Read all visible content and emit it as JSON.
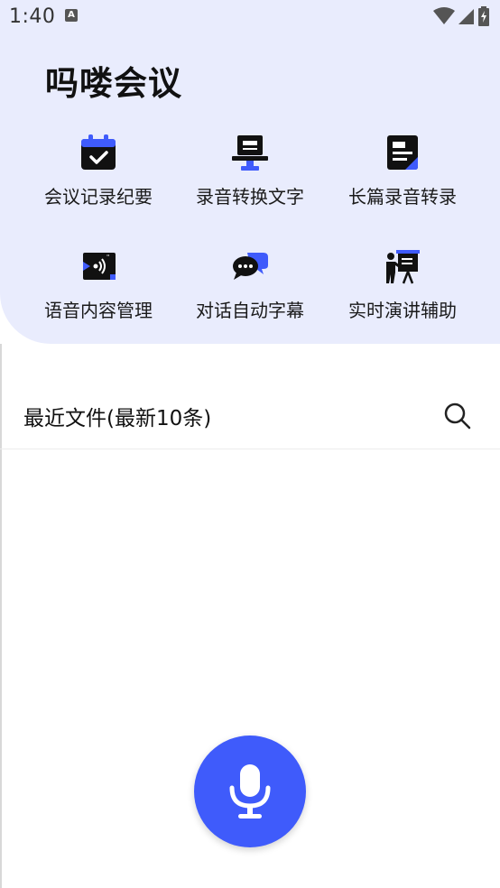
{
  "status_bar": {
    "time": "1:40"
  },
  "app": {
    "title": "吗喽会议"
  },
  "features": [
    {
      "label": "会议记录纪要",
      "icon": "calendar-check-icon"
    },
    {
      "label": "录音转换文字",
      "icon": "monitor-icon"
    },
    {
      "label": "长篇录音转录",
      "icon": "document-icon"
    },
    {
      "label": "语音内容管理",
      "icon": "voice-card-icon"
    },
    {
      "label": "对话自动字幕",
      "icon": "chat-bubbles-icon"
    },
    {
      "label": "实时演讲辅助",
      "icon": "presenter-icon"
    }
  ],
  "recent": {
    "title": "最近文件(最新10条)"
  },
  "colors": {
    "accent": "#3f5bfb",
    "header_bg": "#e9ecfd"
  }
}
